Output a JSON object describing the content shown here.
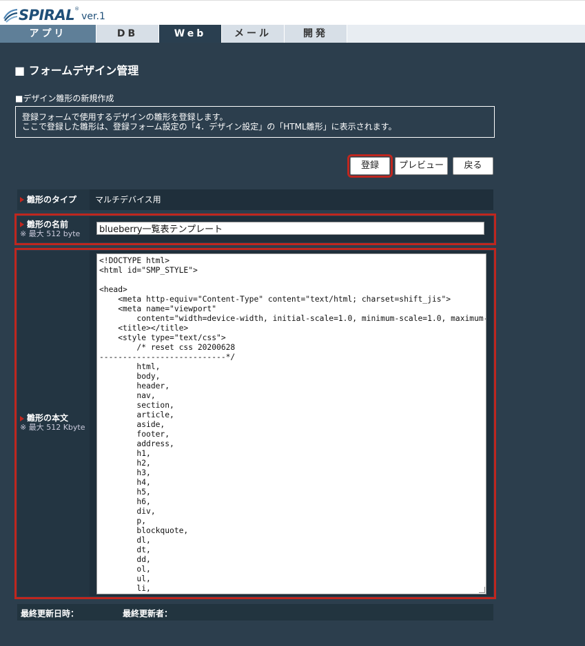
{
  "logo": {
    "brand": "SPIRAL",
    "reg": "®",
    "version": "ver.1"
  },
  "tabs": [
    "アプリ",
    "DB",
    "Web",
    "メール",
    "開発"
  ],
  "page": {
    "title": "■ フォームデザイン管理",
    "section_title": "■デザイン雛形の新規作成",
    "info_line1": "登録フォームで使用するデザインの雛形を登録します。",
    "info_line2": "ここで登録した雛形は、登録フォーム設定の「4．デザイン設定」の「HTML雛形」に表示されます。"
  },
  "buttons": {
    "register": "登録",
    "preview": "プレビュー",
    "back": "戻る"
  },
  "form": {
    "type_label": "雛形のタイプ",
    "type_value": "マルチデバイス用",
    "name_label": "雛形の名前",
    "name_note": "※ 最大 512 byte",
    "name_value": "blueberry一覧表テンプレート",
    "body_label": "雛形の本文",
    "body_note": "※ 最大 512 Kbyte",
    "body_value": "<!DOCTYPE html>\n<html id=\"SMP_STYLE\">\n\n<head>\n    <meta http-equiv=\"Content-Type\" content=\"text/html; charset=shift_jis\">\n    <meta name=\"viewport\"\n        content=\"width=device-width, initial-scale=1.0, minimum-scale=1.0, maximum-sca\n    <title></title>\n    <style type=\"text/css\">\n        /* reset css 20200628\n---------------------------*/\n        html,\n        body,\n        header,\n        nav,\n        section,\n        article,\n        aside,\n        footer,\n        address,\n        h1,\n        h2,\n        h3,\n        h4,\n        h5,\n        h6,\n        div,\n        p,\n        blockquote,\n        dl,\n        dt,\n        dd,\n        ol,\n        ul,\n        li,\n        table,",
    "updated_at_label": "最終更新日時：",
    "updated_by_label": "最終更新者："
  },
  "colors": {
    "accent_red": "#c0261e",
    "panel": "#2c3e4d",
    "brand_blue": "#1f4f78"
  }
}
